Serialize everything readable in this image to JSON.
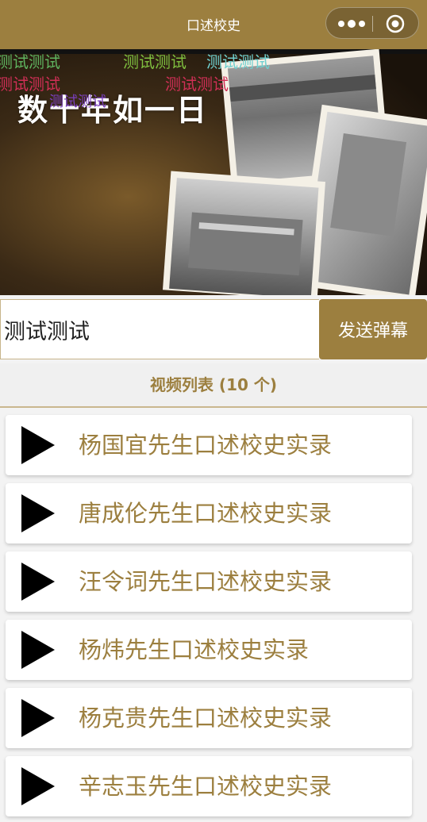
{
  "header": {
    "title": "口述校史"
  },
  "colors": {
    "brand": "#9c7f3f",
    "danmaku_green": "#5fb35f",
    "danmaku_cyan": "#6fd0d0",
    "danmaku_red": "#d02f56",
    "danmaku_purple": "#7a3fbf"
  },
  "video": {
    "banner_text": "数十年如一日",
    "danmaku": [
      "测试测试",
      "测试测试",
      "测试测试",
      "测试测试",
      "测试测试",
      "测试测试"
    ]
  },
  "danmaku_input": {
    "value": "测试测试",
    "send_label": "发送弹幕"
  },
  "list": {
    "header": "视频列表 (10 个)",
    "items": [
      {
        "title": "杨国宜先生口述校史实录"
      },
      {
        "title": "唐成伦先生口述校史实录"
      },
      {
        "title": "汪令词先生口述校史实录"
      },
      {
        "title": "杨炜先生口述校史实录"
      },
      {
        "title": "杨克贵先生口述校史实录"
      },
      {
        "title": "辛志玉先生口述校史实录"
      }
    ]
  }
}
